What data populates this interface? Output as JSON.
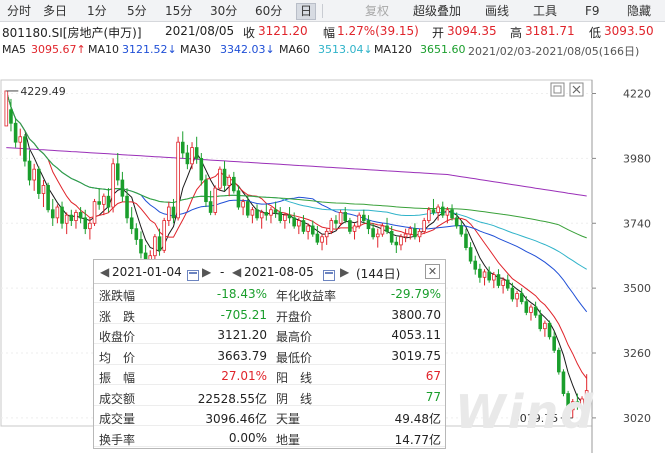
{
  "toolbar": {
    "items": [
      "分时",
      "多日",
      "1分",
      "5分",
      "15分",
      "30分",
      "60分",
      "日",
      "复权",
      "超级叠加",
      "画线",
      "工具",
      "F9",
      "隐藏"
    ],
    "active": "日",
    "disabled": "复权"
  },
  "quote": {
    "code_name": "801180.SI[房地产(申万)]",
    "date": "2021/08/05",
    "close_label": "收",
    "close": "3121.20",
    "change_label": "幅",
    "change": "1.27%(39.15)",
    "open_label": "开",
    "open": "3094.35",
    "high_label": "高",
    "high": "3181.71",
    "low_label": "低",
    "low": "3093.50"
  },
  "ma_line": {
    "ma5_label": "MA5",
    "ma5": "3095.67↑",
    "ma10_label": "MA10",
    "ma10": "3121.52↓",
    "ma30_label": "MA30",
    "ma30": "3342.03↓",
    "ma60_label": "MA60",
    "ma60": "3513.04↓",
    "ma120_label": "MA120",
    "ma120": "3651.60",
    "range": "2021/02/03-2021/08/05(166日)"
  },
  "colors": {
    "ma5": "#1a1a1a",
    "ma10": "#e0242b",
    "ma30": "#1f4fd6",
    "ma60": "#2fb3c9",
    "ma120": "#3aa13a",
    "ma250": "#9a2fb8",
    "up": "#e0242b",
    "down": "#1a9e2c"
  },
  "chart_data": {
    "type": "candlestick",
    "y_ticks": [
      "4220",
      "3980",
      "3740",
      "3500",
      "3260",
      "3020"
    ],
    "ylim": [
      2990,
      4270
    ],
    "max_label": "4229.49",
    "min_label": "3019.75",
    "period": "2021/02/03-2021/08/05",
    "candles": [
      [
        0,
        4100,
        4229.49,
        4160,
        4229.49
      ],
      [
        1,
        4160,
        4200,
        4080,
        4110
      ],
      [
        2,
        4110,
        4130,
        4020,
        4040
      ],
      [
        3,
        4040,
        4090,
        3990,
        4060
      ],
      [
        4,
        4060,
        4070,
        3950,
        3970
      ],
      [
        5,
        3970,
        4010,
        3880,
        3900
      ],
      [
        6,
        3900,
        3960,
        3860,
        3940
      ],
      [
        7,
        3940,
        3950,
        3830,
        3850
      ],
      [
        8,
        3850,
        3900,
        3800,
        3880
      ],
      [
        9,
        3880,
        3890,
        3780,
        3790
      ],
      [
        10,
        3790,
        3830,
        3730,
        3760
      ],
      [
        11,
        3760,
        3810,
        3740,
        3800
      ],
      [
        12,
        3800,
        3820,
        3720,
        3740
      ],
      [
        13,
        3740,
        3780,
        3700,
        3770
      ],
      [
        14,
        3770,
        3790,
        3730,
        3750
      ],
      [
        15,
        3750,
        3790,
        3720,
        3780
      ],
      [
        16,
        3780,
        3800,
        3740,
        3760
      ],
      [
        17,
        3760,
        3790,
        3700,
        3720
      ],
      [
        18,
        3720,
        3760,
        3680,
        3740
      ],
      [
        19,
        3740,
        3830,
        3730,
        3820
      ],
      [
        20,
        3820,
        3870,
        3790,
        3810
      ],
      [
        21,
        3810,
        3850,
        3770,
        3840
      ],
      [
        22,
        3840,
        3870,
        3780,
        3800
      ],
      [
        23,
        3800,
        3980,
        3780,
        3960
      ],
      [
        24,
        3960,
        4000,
        3880,
        3900
      ],
      [
        25,
        3900,
        3930,
        3820,
        3840
      ],
      [
        26,
        3840,
        3870,
        3740,
        3760
      ],
      [
        27,
        3760,
        3800,
        3700,
        3720
      ],
      [
        28,
        3720,
        3740,
        3660,
        3680
      ],
      [
        29,
        3680,
        3710,
        3610,
        3630
      ],
      [
        30,
        3630,
        3660,
        3580,
        3600
      ],
      [
        31,
        3600,
        3640,
        3560,
        3620
      ],
      [
        32,
        3620,
        3700,
        3600,
        3690
      ],
      [
        33,
        3690,
        3720,
        3620,
        3640
      ],
      [
        34,
        3640,
        3760,
        3630,
        3750
      ],
      [
        35,
        3750,
        3820,
        3730,
        3800
      ],
      [
        36,
        3800,
        3830,
        3740,
        3760
      ],
      [
        37,
        3760,
        4060,
        3750,
        4040
      ],
      [
        38,
        4040,
        4080,
        3980,
        4000
      ],
      [
        39,
        4000,
        4030,
        3940,
        3960
      ],
      [
        40,
        3960,
        4040,
        3940,
        4020
      ],
      [
        41,
        4020,
        4060,
        3960,
        3980
      ],
      [
        42,
        3980,
        4000,
        3880,
        3900
      ],
      [
        43,
        3900,
        3920,
        3800,
        3820
      ],
      [
        44,
        3820,
        3860,
        3770,
        3780
      ],
      [
        45,
        3780,
        3880,
        3770,
        3870
      ],
      [
        46,
        3870,
        3950,
        3860,
        3940
      ],
      [
        47,
        3940,
        3970,
        3860,
        3880
      ],
      [
        48,
        3880,
        3920,
        3840,
        3910
      ],
      [
        49,
        3910,
        3930,
        3850,
        3860
      ],
      [
        50,
        3860,
        3880,
        3790,
        3800
      ],
      [
        51,
        3800,
        3830,
        3770,
        3820
      ],
      [
        52,
        3820,
        3840,
        3760,
        3770
      ],
      [
        53,
        3770,
        3800,
        3740,
        3790
      ],
      [
        54,
        3790,
        3810,
        3750,
        3760
      ],
      [
        55,
        3760,
        3790,
        3720,
        3780
      ],
      [
        56,
        3780,
        3810,
        3750,
        3770
      ],
      [
        57,
        3770,
        3800,
        3740,
        3790
      ],
      [
        58,
        3790,
        3820,
        3760,
        3780
      ],
      [
        59,
        3780,
        3800,
        3740,
        3750
      ],
      [
        60,
        3750,
        3780,
        3720,
        3770
      ],
      [
        61,
        3770,
        3800,
        3740,
        3760
      ],
      [
        62,
        3760,
        3780,
        3720,
        3730
      ],
      [
        63,
        3730,
        3760,
        3700,
        3750
      ],
      [
        64,
        3750,
        3770,
        3700,
        3710
      ],
      [
        65,
        3710,
        3740,
        3680,
        3730
      ],
      [
        66,
        3730,
        3750,
        3690,
        3700
      ],
      [
        67,
        3700,
        3730,
        3660,
        3670
      ],
      [
        68,
        3670,
        3700,
        3640,
        3690
      ],
      [
        69,
        3690,
        3720,
        3660,
        3710
      ],
      [
        70,
        3710,
        3760,
        3700,
        3750
      ],
      [
        71,
        3750,
        3770,
        3720,
        3740
      ],
      [
        72,
        3740,
        3790,
        3730,
        3780
      ],
      [
        73,
        3780,
        3800,
        3740,
        3750
      ],
      [
        74,
        3750,
        3760,
        3700,
        3710
      ],
      [
        75,
        3710,
        3740,
        3680,
        3730
      ],
      [
        76,
        3730,
        3780,
        3720,
        3770
      ],
      [
        77,
        3770,
        3790,
        3740,
        3750
      ],
      [
        78,
        3750,
        3770,
        3700,
        3720
      ],
      [
        79,
        3720,
        3740,
        3680,
        3690
      ],
      [
        80,
        3690,
        3720,
        3650,
        3700
      ],
      [
        81,
        3700,
        3740,
        3690,
        3730
      ],
      [
        82,
        3730,
        3760,
        3700,
        3710
      ],
      [
        83,
        3710,
        3730,
        3660,
        3670
      ],
      [
        84,
        3670,
        3690,
        3630,
        3660
      ],
      [
        85,
        3660,
        3700,
        3640,
        3690
      ],
      [
        86,
        3690,
        3720,
        3670,
        3700
      ],
      [
        87,
        3700,
        3730,
        3680,
        3720
      ],
      [
        88,
        3720,
        3740,
        3680,
        3690
      ],
      [
        89,
        3690,
        3720,
        3670,
        3710
      ],
      [
        90,
        3710,
        3760,
        3700,
        3750
      ],
      [
        91,
        3750,
        3800,
        3740,
        3790
      ],
      [
        92,
        3790,
        3830,
        3770,
        3780
      ],
      [
        93,
        3780,
        3810,
        3750,
        3800
      ],
      [
        94,
        3800,
        3820,
        3760,
        3770
      ],
      [
        95,
        3770,
        3800,
        3740,
        3790
      ],
      [
        96,
        3790,
        3810,
        3750,
        3760
      ],
      [
        97,
        3760,
        3780,
        3720,
        3730
      ],
      [
        98,
        3730,
        3750,
        3690,
        3700
      ],
      [
        99,
        3700,
        3720,
        3640,
        3650
      ],
      [
        100,
        3650,
        3670,
        3590,
        3600
      ],
      [
        101,
        3600,
        3620,
        3550,
        3570
      ],
      [
        102,
        3570,
        3590,
        3520,
        3540
      ],
      [
        103,
        3540,
        3570,
        3510,
        3560
      ],
      [
        104,
        3560,
        3580,
        3520,
        3530
      ],
      [
        105,
        3530,
        3560,
        3500,
        3550
      ],
      [
        106,
        3550,
        3570,
        3500,
        3510
      ],
      [
        107,
        3510,
        3540,
        3480,
        3530
      ],
      [
        108,
        3530,
        3550,
        3490,
        3500
      ],
      [
        109,
        3500,
        3520,
        3450,
        3460
      ],
      [
        110,
        3460,
        3490,
        3430,
        3480
      ],
      [
        111,
        3480,
        3500,
        3440,
        3450
      ],
      [
        112,
        3450,
        3470,
        3400,
        3410
      ],
      [
        113,
        3410,
        3440,
        3380,
        3430
      ],
      [
        114,
        3430,
        3450,
        3390,
        3400
      ],
      [
        115,
        3400,
        3420,
        3340,
        3350
      ],
      [
        116,
        3350,
        3380,
        3320,
        3370
      ],
      [
        117,
        3370,
        3380,
        3310,
        3320
      ],
      [
        118,
        3320,
        3340,
        3260,
        3270
      ],
      [
        119,
        3270,
        3280,
        3180,
        3190
      ],
      [
        120,
        3190,
        3200,
        3100,
        3110
      ],
      [
        121,
        3110,
        3120,
        3040,
        3050
      ],
      [
        122,
        3050,
        3090,
        3019.75,
        3080
      ],
      [
        123,
        3080,
        3110,
        3050,
        3060
      ],
      [
        124,
        3060,
        3100,
        3040,
        3090
      ],
      [
        125,
        3094.35,
        3181.71,
        3093.5,
        3121.2
      ]
    ]
  },
  "panel": {
    "date_start": "2021-01-04",
    "date_sep": "-",
    "date_end": "2021-08-05",
    "days": "(144日)",
    "rows": [
      {
        "l1": "涨跌幅",
        "v1": "-18.43%",
        "c1": "green",
        "l2": "年化收益率",
        "v2": "-29.79%",
        "c2": "green"
      },
      {
        "l1": "涨　跌",
        "v1": "-705.21",
        "c1": "green",
        "l2": "开盘价",
        "v2": "3800.70",
        "c2": "black"
      },
      {
        "l1": "收盘价",
        "v1": "3121.20",
        "c1": "black",
        "l2": "最高价",
        "v2": "4053.11",
        "c2": "black"
      },
      {
        "l1": "均　价",
        "v1": "3663.79",
        "c1": "black",
        "l2": "最低价",
        "v2": "3019.75",
        "c2": "black"
      },
      {
        "l1": "振　幅",
        "v1": "27.01%",
        "c1": "red",
        "l2": "阳　线",
        "v2": "67",
        "c2": "red"
      },
      {
        "l1": "成交额",
        "v1": "22528.55亿",
        "c1": "black",
        "l2": "阴　线",
        "v2": "77",
        "c2": "green"
      },
      {
        "l1": "成交量",
        "v1": "3096.46亿",
        "c1": "black",
        "l2": "天量",
        "v2": "49.48亿",
        "c2": "black"
      },
      {
        "l1": "换手率",
        "v1": "0.00%",
        "c1": "black",
        "l2": "地量",
        "v2": "14.77亿",
        "c2": "black"
      }
    ]
  },
  "watermark": "Wind"
}
